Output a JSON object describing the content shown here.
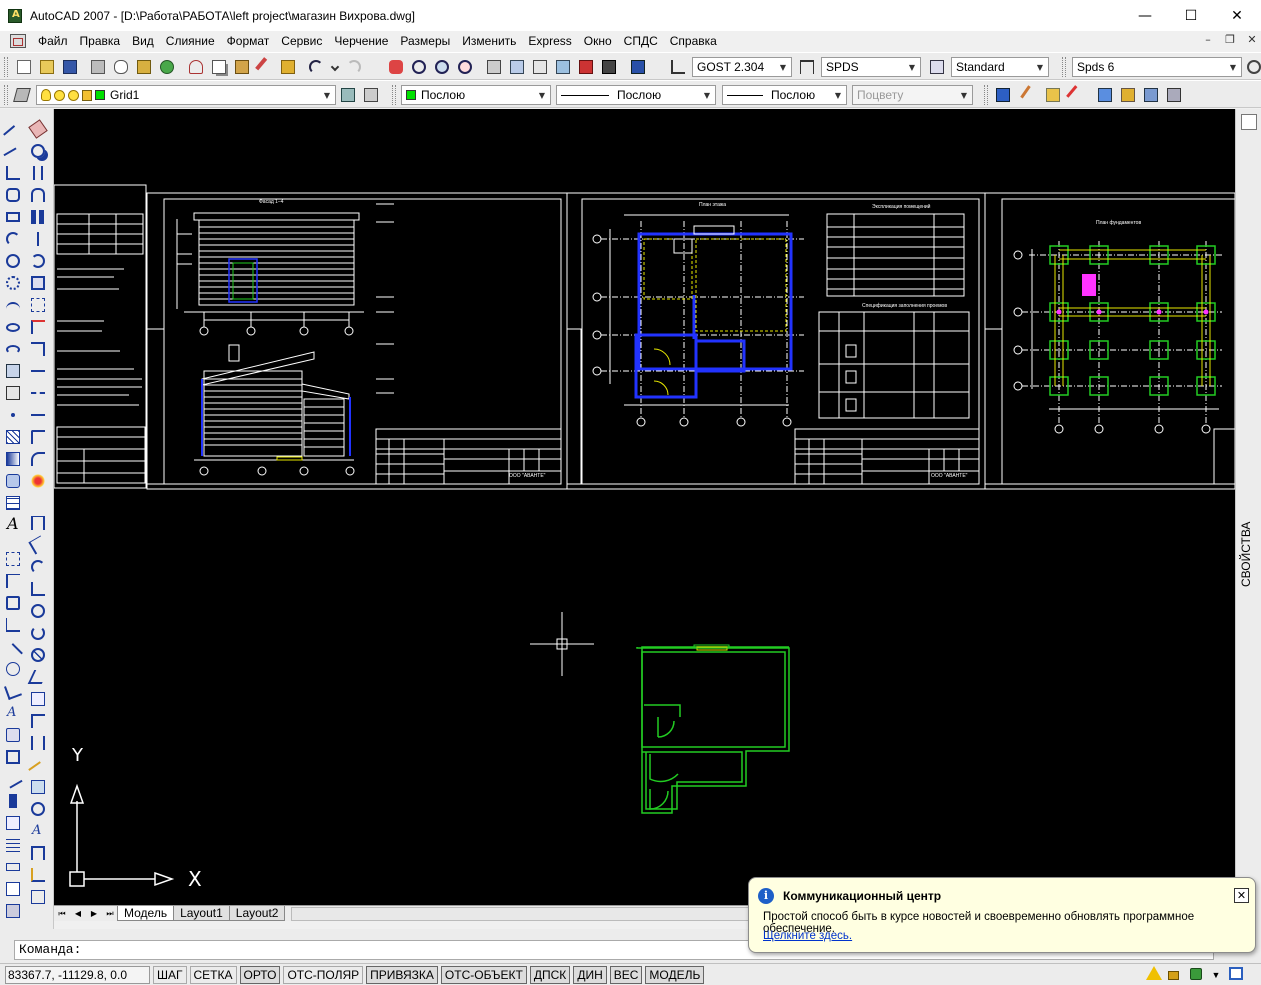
{
  "window": {
    "title": "AutoCAD 2007 - [D:\\Работа\\РАБОТА\\left project\\магазин Вихрова.dwg]",
    "minimize": "—",
    "maximize": "☐",
    "close": "✕"
  },
  "menu": {
    "items": [
      "Файл",
      "Правка",
      "Вид",
      "Слияние",
      "Формат",
      "Сервис",
      "Черчение",
      "Размеры",
      "Изменить",
      "Express",
      "Окно",
      "СПДС",
      "Справка"
    ],
    "doc_minimize": "–",
    "doc_restore": "❐",
    "doc_close": "✕"
  },
  "toolbar": {
    "text_style": "GOST 2.304",
    "dim_style": "SPDS",
    "table_style": "Standard",
    "spds_style": "Spds 6",
    "layer": "Grid1",
    "color": "Послою",
    "linetype": "Послою",
    "lineweight": "Послою",
    "plotstyle": "Поцвету"
  },
  "sidepanel": {
    "properties": "СВОЙСТВА"
  },
  "canvas": {
    "ucs_y": "Y",
    "ucs_x": "X"
  },
  "layout_tabs": [
    "Модель",
    "Layout1",
    "Layout2"
  ],
  "command": {
    "prompt": "Команда:"
  },
  "status": {
    "coords": "83367.7, -11129.8, 0.0",
    "toggles": [
      "ШАГ",
      "СЕТКА",
      "ОРТО",
      "ОТС-ПОЛЯР",
      "ПРИВЯЗКА",
      "ОТС-ОБЪЕКТ",
      "ДПСК",
      "ДИН",
      "ВЕС",
      "МОДЕЛЬ"
    ]
  },
  "notification": {
    "title": "Коммуникационный центр",
    "body": "Простой способ быть в курсе новостей и своевременно обновлять программное обеспечение.",
    "link": "Щелкните здесь."
  },
  "sheets": {
    "sheet1_title": "Фасад 1–4",
    "sheet2_title": "План этажа",
    "sheet3_title": "План фундаментов",
    "room_table_title": "Экспликация помещений",
    "doors_table_title": "Спецификация заполнения проемов",
    "company": "ООО \"АВАНТЕ\""
  },
  "colors": {
    "canvas_bg": "#000000",
    "wall_green": "#22cc22",
    "blue_lines": "#2233ff",
    "magenta": "#ff33ff",
    "yellow": "#e8e800"
  }
}
